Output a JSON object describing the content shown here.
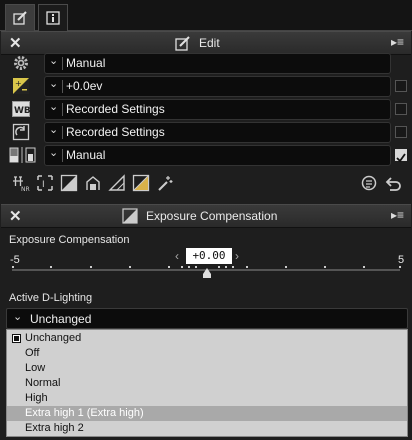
{
  "tabs": [
    {
      "icon": "edit-pencil-icon",
      "active": true
    },
    {
      "icon": "info-icon",
      "active": false
    }
  ],
  "edit_panel": {
    "title": "Edit",
    "rows": [
      {
        "icon": "gear-icon",
        "value": "Manual",
        "has_checkbox": false
      },
      {
        "icon": "exposure-compensation-icon",
        "value": "+0.0ev",
        "has_checkbox": true,
        "checked": false
      },
      {
        "icon": "white-balance-icon",
        "value": "Recorded Settings",
        "has_checkbox": true,
        "checked": false
      },
      {
        "icon": "picture-control-icon",
        "value": "Recorded Settings",
        "has_checkbox": true,
        "checked": false
      },
      {
        "icon": "lens-correction-icon",
        "value": "Manual",
        "has_checkbox": true,
        "checked": true
      }
    ]
  },
  "tool_icons": [
    "noise-reduction-icon",
    "crop-icon",
    "levels-icon",
    "color-booster-icon",
    "straighten-icon",
    "brightness-icon",
    "retouch-brush-icon"
  ],
  "exposure_panel": {
    "title": "Exposure Compensation",
    "slider_label": "Exposure Compensation",
    "min_label": "-5",
    "max_label": "5",
    "value": "+0.00",
    "decrement": "‹",
    "increment": "›"
  },
  "adl": {
    "label": "Active D-Lighting",
    "selected": "Unchanged",
    "options": [
      "Unchanged",
      "Off",
      "Low",
      "Normal",
      "High",
      "Extra high 1 (Extra high)",
      "Extra high 2"
    ],
    "checked_option": "Unchanged",
    "highlighted_option": "Extra high 1 (Extra high)"
  }
}
